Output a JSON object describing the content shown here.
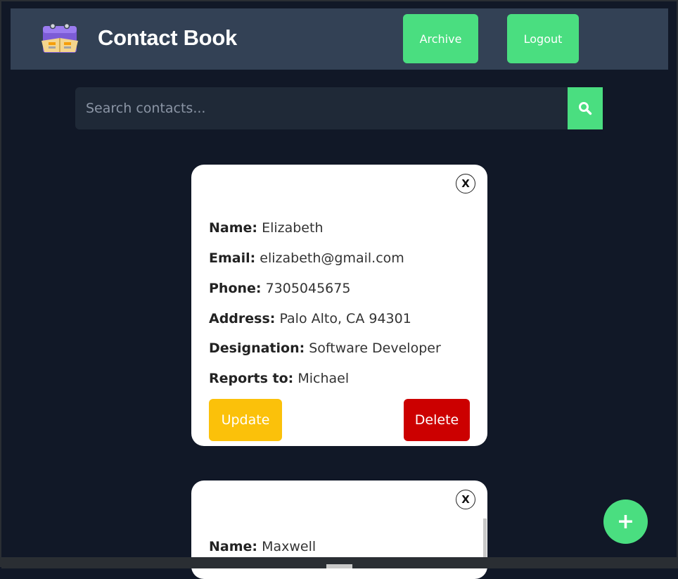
{
  "header": {
    "title": "Contact Book",
    "archive_label": "Archive",
    "logout_label": "Logout"
  },
  "search": {
    "placeholder": "Search contacts...",
    "icon": "search-icon"
  },
  "contacts": [
    {
      "close_label": "X",
      "name_label": "Name:",
      "name": "Elizabeth",
      "email_label": "Email:",
      "email": "elizabeth@gmail.com",
      "phone_label": "Phone:",
      "phone": "7305045675",
      "address_label": "Address:",
      "address": "Palo Alto, CA 94301",
      "designation_label": "Designation:",
      "designation": "Software Developer",
      "reports_label": "Reports to:",
      "reports_to": "Michael",
      "update_label": "Update",
      "delete_label": "Delete"
    },
    {
      "close_label": "X",
      "name_label": "Name:",
      "name": "Maxwell"
    }
  ],
  "fab": {
    "label": "+"
  },
  "colors": {
    "background": "#111827",
    "navbar": "#334155",
    "accent_green": "#4ade80",
    "update_yellow": "#fbc10a",
    "delete_red": "#cc0000"
  }
}
